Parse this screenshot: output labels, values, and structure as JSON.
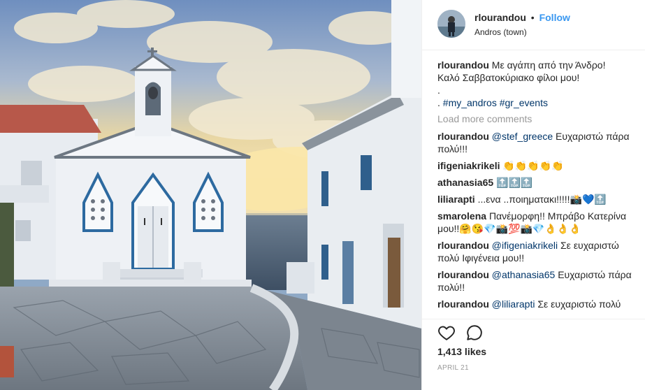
{
  "post": {
    "photo_alt": "",
    "author": {
      "username": "rlourandou",
      "follow_label": "Follow",
      "separator": "•",
      "location": "Andros (town)"
    },
    "caption": {
      "username": "rlourandou",
      "line1": "Με αγάπη από την Άνδρο!",
      "line2": "Καλό Σαββατοκύριακο φίλοι μου!",
      "line3": ".",
      "line4_prefix": ".",
      "hashtags": [
        "#my_andros",
        "#gr_events"
      ]
    },
    "load_more_label": "Load more comments",
    "comments": [
      {
        "user": "rlourandou",
        "mention": "@stef_greece",
        "text": "Ευχαριστώ πάρα πολύ!!!"
      },
      {
        "user": "ifigeniakrikeli",
        "mention": "",
        "text": "👏👏👏👏👏"
      },
      {
        "user": "athanasia65",
        "mention": "",
        "text": "🔝🔝🔝"
      },
      {
        "user": "liliarapti",
        "mention": "",
        "text": "...ενα ..ποιηματακι!!!!!📸💙🔝"
      },
      {
        "user": "smarolena",
        "mention": "",
        "text": "Πανέμορφη!! Μπράβο Κατερίνα μου!!🤗😘💎📸💯📸💎👌👌👌"
      },
      {
        "user": "rlourandou",
        "mention": "@ifigeniakrikeli",
        "text": "Σε ευχαριστώ πολύ Ιφιγένεια μου!!"
      },
      {
        "user": "rlourandou",
        "mention": "@athanasia65",
        "text": "Ευχαριστώ πάρα πολύ!!"
      },
      {
        "user": "rlourandou",
        "mention": "@liliarapti",
        "text": "Σε ευχαριστώ πολύ"
      }
    ],
    "icons": {
      "like": "heart-icon",
      "comment": "speech-bubble-icon"
    },
    "likes_label": "1,413 likes",
    "date_label": "APRIL 21",
    "colors": {
      "link_blue": "#3897f0",
      "hashtag": "#003569",
      "muted": "#999999",
      "text": "#262626"
    }
  }
}
